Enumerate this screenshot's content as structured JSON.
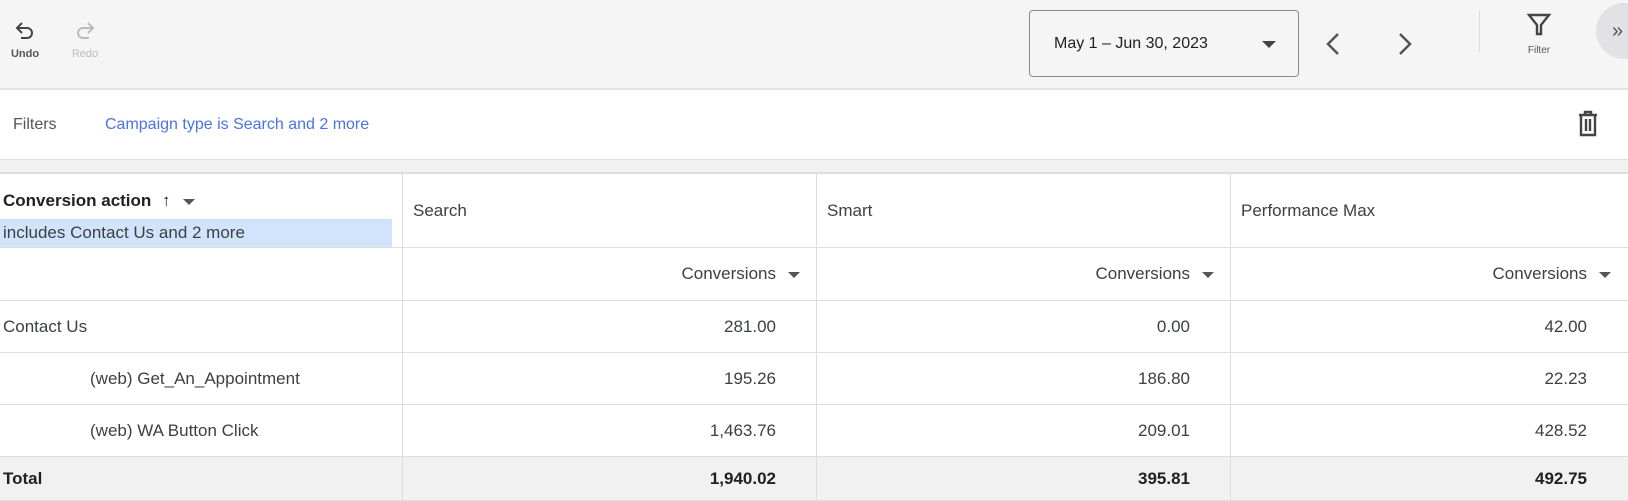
{
  "toolbar": {
    "undo": "Undo",
    "redo": "Redo",
    "date_range": "May 1 – Jun 30, 2023",
    "filter": "Filter",
    "more": "»"
  },
  "filters": {
    "label": "Filters",
    "value": "Campaign type is Search and 2 more"
  },
  "table": {
    "row_header": "Conversion action",
    "row_filter": "includes Contact Us and 2 more",
    "columns": [
      "Search",
      "Smart",
      "Performance Max"
    ],
    "metric": "Conversions",
    "rows": [
      {
        "name": "Contact Us",
        "values": [
          "281.00",
          "0.00",
          "42.00"
        ]
      },
      {
        "name": "(web) Get_An_Appointment",
        "values": [
          "195.26",
          "186.80",
          "22.23"
        ]
      },
      {
        "name": "(web) WA Button Click",
        "values": [
          "1,463.76",
          "209.01",
          "428.52"
        ]
      }
    ],
    "total": {
      "name": "Total",
      "values": [
        "1,940.02",
        "395.81",
        "492.75"
      ]
    }
  },
  "colors": {
    "link": "#4a73e8",
    "chip": "#d2e3fc"
  }
}
